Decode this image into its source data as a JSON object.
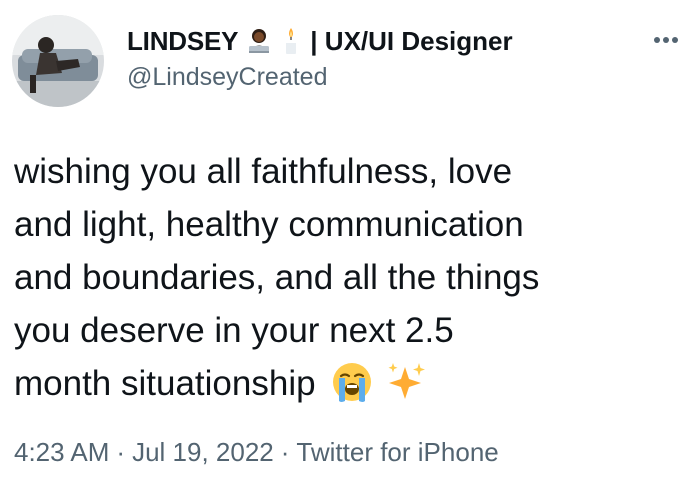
{
  "author": {
    "display_name": "LINDSEY",
    "name_suffix": "| UX/UI Designer",
    "handle": "@LindseyCreated",
    "name_emojis": [
      "woman-technologist-dark-skin-icon",
      "candle-icon"
    ]
  },
  "tweet": {
    "text_lines": [
      "wishing you all faithfulness, love",
      "and light, healthy communication",
      "and boundaries, and all the things",
      "you deserve in your next 2.5",
      "month situationship"
    ],
    "trailing_emojis": [
      "loudly-crying-face-icon",
      "sparkles-icon"
    ]
  },
  "meta": {
    "time": "4:23 AM",
    "separator": "·",
    "date": "Jul 19, 2022",
    "source": "Twitter for iPhone"
  },
  "colors": {
    "text_primary": "#0f1419",
    "text_secondary": "#536471",
    "background": "#ffffff"
  }
}
